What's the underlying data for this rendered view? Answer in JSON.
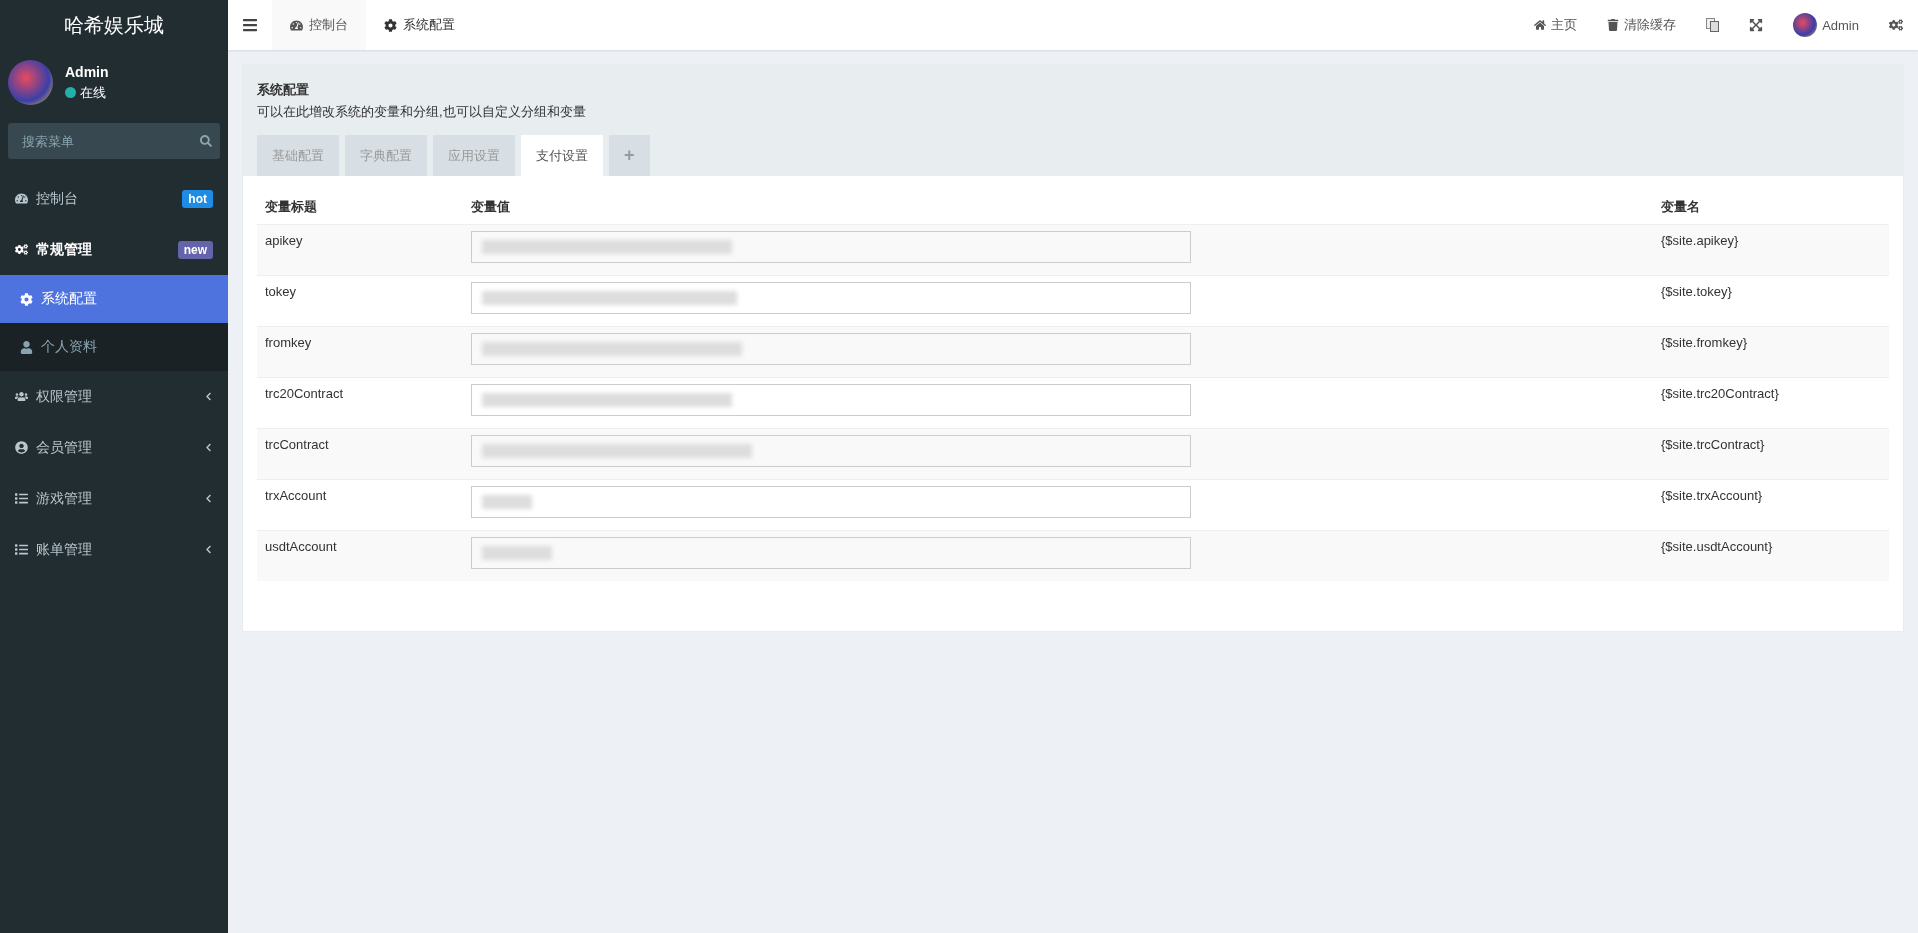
{
  "sidebar": {
    "brand": "哈希娱乐城",
    "user": {
      "name": "Admin",
      "status": "在线",
      "online": true
    },
    "search": {
      "placeholder": "搜索菜单"
    },
    "items": [
      {
        "label": "控制台",
        "badge": {
          "text": "hot",
          "color": "#1e8ce5"
        },
        "expanded": false,
        "has_caret": false
      },
      {
        "label": "常规管理",
        "badge": {
          "text": "new",
          "color": "#6563a9"
        },
        "expanded": true,
        "has_caret": false,
        "children": [
          {
            "label": "系统配置",
            "selected": true
          },
          {
            "label": "个人资料",
            "selected": false
          }
        ]
      },
      {
        "label": "权限管理",
        "expanded": false,
        "has_caret": true
      },
      {
        "label": "会员管理",
        "expanded": false,
        "has_caret": true
      },
      {
        "label": "游戏管理",
        "expanded": false,
        "has_caret": true
      },
      {
        "label": "账单管理",
        "expanded": false,
        "has_caret": true
      }
    ]
  },
  "topbar": {
    "tabs": [
      {
        "label": "控制台",
        "selected": false
      },
      {
        "label": "系统配置",
        "selected": true
      }
    ],
    "links": [
      {
        "label": "主页"
      },
      {
        "label": "清除缓存"
      }
    ],
    "user": {
      "label": "Admin"
    }
  },
  "panel": {
    "title": "系统配置",
    "subtitle": "可以在此增改系统的变量和分组,也可以自定义分组和变量",
    "tabs": [
      {
        "label": "基础配置",
        "selected": false
      },
      {
        "label": "字典配置",
        "selected": false
      },
      {
        "label": "应用设置",
        "selected": false
      },
      {
        "label": "支付设置",
        "selected": true
      },
      {
        "label": "+",
        "selected": false
      }
    ],
    "table": {
      "columns": [
        "变量标题",
        "变量值",
        "变量名"
      ],
      "rows": [
        {
          "title": "apikey",
          "name": "{$site.apikey}"
        },
        {
          "title": "tokey",
          "name": "{$site.tokey}"
        },
        {
          "title": "fromkey",
          "name": "{$site.fromkey}"
        },
        {
          "title": "trc20Contract",
          "name": "{$site.trc20Contract}"
        },
        {
          "title": "trcContract",
          "name": "{$site.trcContract}"
        },
        {
          "title": "trxAccount",
          "name": "{$site.trxAccount}"
        },
        {
          "title": "usdtAccount",
          "name": "{$site.usdtAccount}"
        }
      ]
    }
  }
}
